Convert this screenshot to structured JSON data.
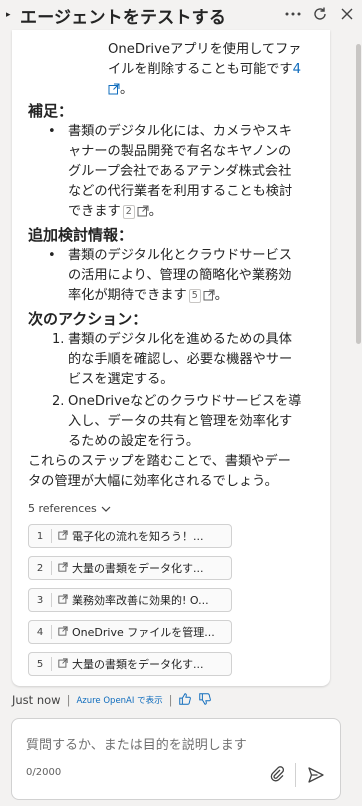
{
  "header": {
    "title": "エージェントをテストする",
    "icons": [
      "more-icon",
      "refresh-icon",
      "close-icon"
    ]
  },
  "message": {
    "intro_line1": "OneDriveアプリを使用してファ",
    "intro_line2": "イルを削除することも可能です",
    "intro_cite": "4",
    "intro_end": "。",
    "sections": [
      {
        "heading": "補足：",
        "bullet_lines": [
          "書類のデジタル化には、カメラやスキ",
          "ャナーの製品開発で有名なキヤノンの",
          "グループ会社であるアテンダ株式会社",
          "などの代行業者を利用することも検討",
          "できます"
        ],
        "cite": "2",
        "end": "。"
      },
      {
        "heading": "追加検討情報：",
        "bullet_lines": [
          "書類のデジタル化とクラウドサービス",
          "の活用により、管理の簡略化や業務効",
          "率化が期待できます"
        ],
        "cite": "5",
        "end": "。"
      },
      {
        "heading": "次のアクション：",
        "numbered": [
          {
            "num": "1.",
            "lines": [
              "書類のデジタル化を進めるための具体",
              "的な手順を確認し、必要な機器やサー",
              "ビスを選定する。"
            ]
          },
          {
            "num": "2.",
            "lines": [
              "OneDriveなどのクラウドサービスを導",
              "入し、データの共有と管理を効率化す",
              "るための設定を行う。"
            ]
          }
        ]
      }
    ],
    "closing_line1": "これらのステップを踏むことで、書類やデー",
    "closing_line2": "タの管理が大幅に効率化されるでしょう。"
  },
  "references": {
    "toggle_label": "5 references",
    "items": [
      {
        "num": "1",
        "title": "電子化の流れを知ろう！..."
      },
      {
        "num": "2",
        "title": "大量の書類をデータ化す..."
      },
      {
        "num": "3",
        "title": "業務効率改善に効果的! O..."
      },
      {
        "num": "4",
        "title": "OneDrive ファイルを管理..."
      },
      {
        "num": "5",
        "title": "大量の書類をデータ化す..."
      }
    ]
  },
  "meta": {
    "time": "Just now",
    "azure": "Azure OpenAI で表示"
  },
  "composer": {
    "placeholder": "質問するか、または目的を説明します",
    "counter": "0/2000"
  },
  "colors": {
    "link": "#0f6cbd",
    "background": "#f3f2f1",
    "card": "#ffffff"
  }
}
